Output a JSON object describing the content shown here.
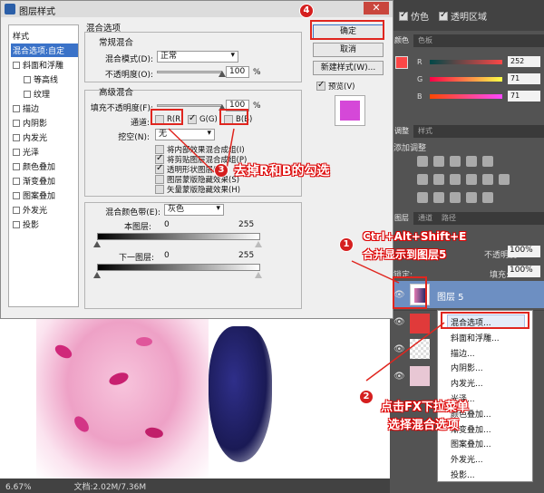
{
  "topbar": {
    "option_simulate": "仿色",
    "option_transparency": "透明区域"
  },
  "color_panel": {
    "tabs": [
      "颜色",
      "色板"
    ],
    "rows": [
      {
        "channel": "R",
        "value": "252"
      },
      {
        "channel": "G",
        "value": "71"
      },
      {
        "channel": "B",
        "value": "71"
      }
    ]
  },
  "adjust_panel": {
    "tabs": [
      "调整",
      "样式"
    ],
    "title": "添加调整"
  },
  "layers_panel": {
    "tabs": [
      "图层",
      "通道",
      "路径"
    ],
    "opacity_label": "不透明度:",
    "opacity_value": "100%",
    "lock_label": "锁定:",
    "fill_label": "填充:",
    "fill_value": "100%",
    "layer_name": "图层 5"
  },
  "statusbar": {
    "zoom": "6.67%",
    "doc": "文档:2.02M/7.36M"
  },
  "dialog": {
    "title": "图层样式",
    "close": "✕",
    "style_list": [
      {
        "label": "样式",
        "checkbox": false,
        "indent": 0,
        "selected": false
      },
      {
        "label": "混合选项:自定",
        "checkbox": false,
        "indent": 0,
        "selected": true
      },
      {
        "label": "斜面和浮雕",
        "checkbox": true,
        "indent": 0,
        "selected": false
      },
      {
        "label": "等高线",
        "checkbox": true,
        "indent": 1,
        "selected": false
      },
      {
        "label": "纹理",
        "checkbox": true,
        "indent": 1,
        "selected": false
      },
      {
        "label": "描边",
        "checkbox": true,
        "indent": 0,
        "selected": false
      },
      {
        "label": "内阴影",
        "checkbox": true,
        "indent": 0,
        "selected": false
      },
      {
        "label": "内发光",
        "checkbox": true,
        "indent": 0,
        "selected": false
      },
      {
        "label": "光泽",
        "checkbox": true,
        "indent": 0,
        "selected": false
      },
      {
        "label": "颜色叠加",
        "checkbox": true,
        "indent": 0,
        "selected": false
      },
      {
        "label": "渐变叠加",
        "checkbox": true,
        "indent": 0,
        "selected": false
      },
      {
        "label": "图案叠加",
        "checkbox": true,
        "indent": 0,
        "selected": false
      },
      {
        "label": "外发光",
        "checkbox": true,
        "indent": 0,
        "selected": false
      },
      {
        "label": "投影",
        "checkbox": true,
        "indent": 0,
        "selected": false
      }
    ],
    "blend_section_title": "混合选项",
    "general_title": "常规混合",
    "blend_mode_label": "混合模式(D):",
    "blend_mode_value": "正常",
    "opacity_label": "不透明度(O):",
    "opacity_value": "100",
    "advanced_title": "高级混合",
    "fill_opacity_label": "填充不透明度(F):",
    "fill_opacity_value": "100",
    "percent": "%",
    "channels_label": "通道:",
    "channel_r": "R(R)",
    "channel_g": "G(G)",
    "channel_b": "B(B)",
    "channel_r_checked": false,
    "channel_g_checked": true,
    "channel_b_checked": false,
    "knockout_label": "挖空(N):",
    "knockout_value": "无",
    "options": [
      {
        "label": "将内部效果混合成组(I)",
        "checked": false
      },
      {
        "label": "将剪贴图层混合成组(P)",
        "checked": true
      },
      {
        "label": "透明形状图层(T)",
        "checked": true
      },
      {
        "label": "图层蒙版隐藏效果(S)",
        "checked": false
      },
      {
        "label": "矢量蒙版隐藏效果(H)",
        "checked": false
      }
    ],
    "blend_if_label": "混合颜色带(E):",
    "blend_if_value": "灰色",
    "this_layer_label": "本图层:",
    "under_layer_label": "下一图层:",
    "range_min": "0",
    "range_max": "255",
    "buttons": {
      "ok": "确定",
      "cancel": "取消",
      "new_style": "新建样式(W)...",
      "preview": "预览(V)"
    },
    "preview_checked": true
  },
  "context_menu": {
    "items": [
      "混合选项...",
      "斜面和浮雕...",
      "描边...",
      "内阴影...",
      "内发光...",
      "光泽...",
      "颜色叠加...",
      "渐变叠加...",
      "图案叠加...",
      "外发光...",
      "投影..."
    ]
  },
  "annotations": {
    "step1_num": "1",
    "step1_line1": "Ctrl+Alt+Shift+E",
    "step1_line2": "合并显示到图层5",
    "step2_num": "2",
    "step2_line1": "点击FX下拉菜单",
    "step2_line2": "选择混合选项",
    "step3_num": "3",
    "step3_text": "去掉R和B的勾选",
    "step4_num": "4"
  },
  "colors": {
    "annotation_red": "#e0261f",
    "selection_blue": "#3a72c8",
    "preview_swatch": "#d548d8",
    "fg_color": "#fc4747"
  }
}
